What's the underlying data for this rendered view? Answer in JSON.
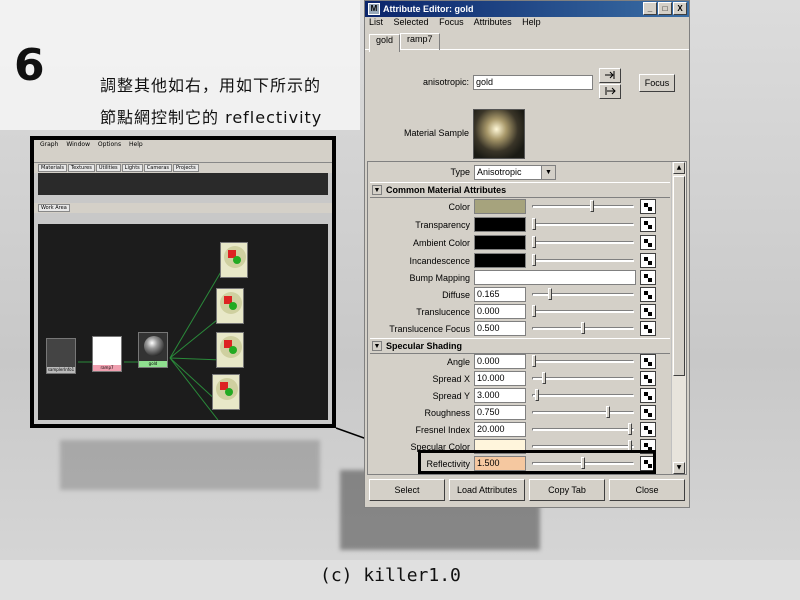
{
  "step": "6",
  "note_lines": [
    "調整其他如右，用如下所示的",
    "節點網控制它的 reflectivity"
  ],
  "footer": "(c) killer1.0",
  "inset": {
    "menu": [
      "Graph",
      "Window",
      "Options",
      "Help"
    ],
    "tabs": [
      "Materials",
      "Textures",
      "Utilities",
      "Lights",
      "Cameras",
      "Projects"
    ],
    "work_tab": "Work Area",
    "nodes": {
      "place": "samplerInfo1",
      "ramp": "ramp7",
      "material": "gold"
    }
  },
  "ae": {
    "title": "Attribute Editor: gold",
    "app_icon": "M",
    "window_buttons": [
      "_",
      "□",
      "X"
    ],
    "menu": [
      "List",
      "Selected",
      "Focus",
      "Attributes",
      "Help"
    ],
    "tabs": [
      "gold",
      "ramp7"
    ],
    "type_name_label": "anisotropic:",
    "type_name_value": "gold",
    "focus_button": "Focus",
    "sample_label": "Material Sample",
    "type_label": "Type",
    "type_value": "Anisotropic",
    "sections": {
      "common": "Common Material Attributes",
      "specular": "Specular Shading"
    },
    "common_attrs": {
      "color": "Color",
      "transparency": "Transparency",
      "ambient": "Ambient Color",
      "incandescence": "Incandescence",
      "bump": "Bump Mapping",
      "diffuse": "Diffuse",
      "diffuse_value": "0.165",
      "translucence": "Translucence",
      "translucence_value": "0.000",
      "translucence_focus": "Translucence Focus",
      "translucence_focus_value": "0.500"
    },
    "specular_attrs": {
      "angle": "Angle",
      "angle_value": "0.000",
      "spread_x": "Spread X",
      "spread_x_value": "10.000",
      "spread_y": "Spread Y",
      "spread_y_value": "3.000",
      "roughness": "Roughness",
      "roughness_value": "0.750",
      "fresnel": "Fresnel Index",
      "fresnel_value": "20.000",
      "spec_color": "Specular Color",
      "reflectivity": "Reflectivity",
      "reflectivity_value": "1.500"
    },
    "buttons": {
      "select": "Select",
      "load": "Load Attributes",
      "copy": "Copy Tab",
      "close": "Close"
    }
  },
  "colors": {
    "color_swatch": "#a6a37d",
    "specular_color_swatch": "#fff5dc",
    "reflectivity_field": "#f5c8a0",
    "title_bar": "#0a246a"
  }
}
